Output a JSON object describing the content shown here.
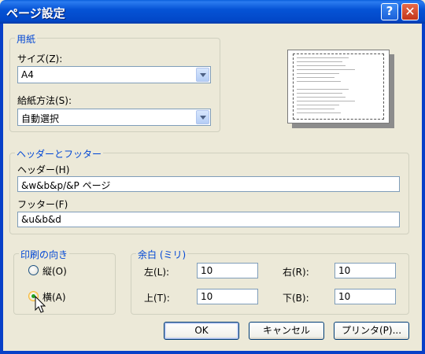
{
  "window": {
    "title": "ページ設定",
    "help_label": "?",
    "close_label": "✕"
  },
  "paper": {
    "legend": "用紙",
    "size_label": "サイズ(Z):",
    "size_value": "A4",
    "source_label": "給紙方法(S):",
    "source_value": "自動選択"
  },
  "headers": {
    "legend": "ヘッダーとフッター",
    "header_label": "ヘッダー(H)",
    "header_value": "&w&b&p/&P ページ",
    "footer_label": "フッター(F)",
    "footer_value": "&u&b&d"
  },
  "orientation": {
    "legend": "印刷の向き",
    "portrait_label": "縦(O)",
    "landscape_label": "横(A)",
    "selected": "landscape"
  },
  "margins": {
    "legend": "余白 (ミリ)",
    "left_label": "左(L):",
    "left_value": "10",
    "right_label": "右(R):",
    "right_value": "10",
    "top_label": "上(T):",
    "top_value": "10",
    "bottom_label": "下(B):",
    "bottom_value": "10"
  },
  "buttons": {
    "ok": "OK",
    "cancel": "キャンセル",
    "printer": "プリンタ(P)..."
  },
  "icons": {
    "help": "help-icon",
    "close": "close-icon",
    "dropdown": "chevron-down-icon",
    "cursor": "mouse-pointer-icon"
  },
  "colors": {
    "titlebar": "#0553d6",
    "legend_text": "#0046d5",
    "dialog_bg": "#ece9d8",
    "radio_check": "#21a121"
  }
}
